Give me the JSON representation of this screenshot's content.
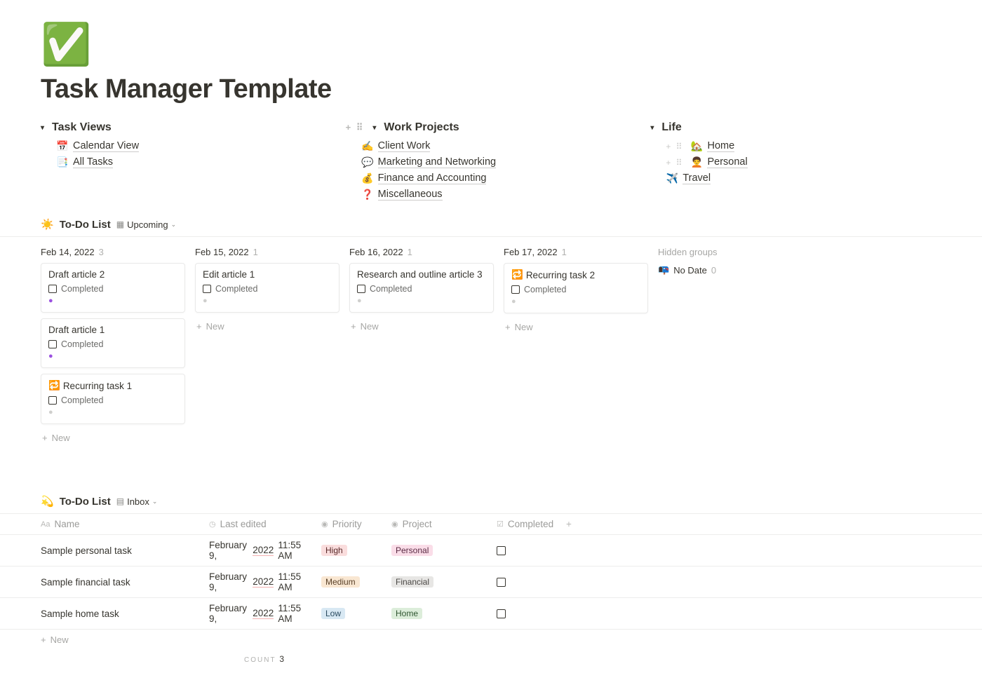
{
  "page": {
    "icon": "✅",
    "title": "Task Manager Template"
  },
  "toggles": [
    {
      "title": "Task Views",
      "show_actions": false,
      "items": [
        {
          "icon": "📅",
          "label": "Calendar View",
          "show_actions": false
        },
        {
          "icon": "📑",
          "label": "All Tasks",
          "show_actions": false
        }
      ]
    },
    {
      "title": "Work Projects",
      "show_actions": true,
      "items": [
        {
          "icon": "✍️",
          "label": "Client Work",
          "show_actions": false
        },
        {
          "icon": "💬",
          "label": "Marketing and Networking",
          "show_actions": false
        },
        {
          "icon": "💰",
          "label": "Finance and Accounting",
          "show_actions": false
        },
        {
          "icon": "❓",
          "label": "Miscellaneous",
          "show_actions": false
        }
      ]
    },
    {
      "title": "Life",
      "show_actions": false,
      "items": [
        {
          "icon": "🏡",
          "label": "Home",
          "show_actions": true
        },
        {
          "icon": "🧑‍🦱",
          "label": "Personal",
          "show_actions": true
        },
        {
          "icon": "✈️",
          "label": "Travel",
          "show_actions": false
        }
      ]
    }
  ],
  "board": {
    "icon": "☀️",
    "title": "To-Do List",
    "view_icon": "▦",
    "view_name": "Upcoming",
    "columns": [
      {
        "date": "Feb 14, 2022",
        "count": 3,
        "cards": [
          {
            "title": "Draft article 2",
            "completed_label": "Completed",
            "dot": "purple"
          },
          {
            "title": "Draft article 1",
            "completed_label": "Completed",
            "dot": "purple"
          },
          {
            "icon": "🔁",
            "title": "Recurring task 1",
            "completed_label": "Completed",
            "dot": "grey"
          }
        ]
      },
      {
        "date": "Feb 15, 2022",
        "count": 1,
        "cards": [
          {
            "title": "Edit article 1",
            "completed_label": "Completed",
            "dot": "grey"
          }
        ]
      },
      {
        "date": "Feb 16, 2022",
        "count": 1,
        "cards": [
          {
            "title": "Research and outline article 3",
            "completed_label": "Completed",
            "dot": "grey"
          }
        ]
      },
      {
        "date": "Feb 17, 2022",
        "count": 1,
        "cards": [
          {
            "icon": "🔁",
            "title": "Recurring task 2",
            "completed_label": "Completed",
            "dot": "grey"
          }
        ]
      }
    ],
    "hidden_label": "Hidden groups",
    "hidden_items": [
      {
        "icon": "📭",
        "label": "No Date",
        "count": 0
      }
    ],
    "new_label": "New"
  },
  "table_view": {
    "icon": "💫",
    "title": "To-Do List",
    "view_icon": "▤",
    "view_name": "Inbox",
    "headers": {
      "name": "Name",
      "last_edited": "Last edited",
      "priority": "Priority",
      "project": "Project",
      "completed": "Completed"
    },
    "rows": [
      {
        "name": "Sample personal task",
        "last_edited_pre": "February 9, ",
        "last_edited_year": "2022",
        "last_edited_post": " 11:55 AM",
        "priority": "High",
        "priority_cls": "tag-high",
        "project": "Personal",
        "project_cls": "tag-personal"
      },
      {
        "name": "Sample financial task",
        "last_edited_pre": "February 9, ",
        "last_edited_year": "2022",
        "last_edited_post": " 11:55 AM",
        "priority": "Medium",
        "priority_cls": "tag-med",
        "project": "Financial",
        "project_cls": "tag-financial"
      },
      {
        "name": "Sample home task",
        "last_edited_pre": "February 9, ",
        "last_edited_year": "2022",
        "last_edited_post": " 11:55 AM",
        "priority": "Low",
        "priority_cls": "tag-low",
        "project": "Home",
        "project_cls": "tag-home"
      }
    ],
    "new_label": "New",
    "count_label": "COUNT",
    "count_value": "3"
  }
}
